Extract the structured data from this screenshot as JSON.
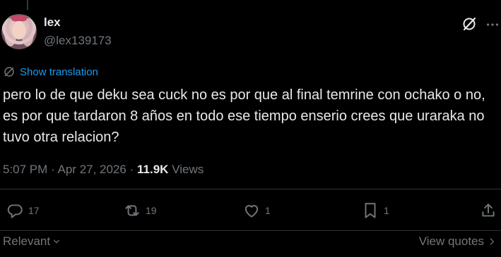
{
  "author": {
    "display_name": "lex",
    "handle": "@lex139173"
  },
  "translate": {
    "label": "Show translation"
  },
  "tweet": {
    "text": "pero lo de que deku sea cuck no es por que al final temrine con ochako o no, es por que tardaron 8 años en todo ese tiempo enserio crees que uraraka no tuvo otra relacion?"
  },
  "meta": {
    "time": "5:07 PM",
    "separator": "·",
    "date": "Apr 27, 2026",
    "views_count": "11.9K",
    "views_label": "Views"
  },
  "actions": {
    "replies": "17",
    "reposts": "19",
    "likes": "1",
    "bookmarks": "1"
  },
  "footer": {
    "sort_label": "Relevant",
    "view_quotes_label": "View quotes"
  },
  "icons": {
    "grok": "grok-icon",
    "more": "more-icon",
    "translate": "globe-slash-icon",
    "reply": "reply-icon",
    "repost": "repost-icon",
    "like": "heart-icon",
    "bookmark": "bookmark-icon",
    "share": "share-icon"
  },
  "colors": {
    "background": "#000000",
    "text": "#e7e9ea",
    "secondary": "#71767b",
    "accent": "#1d9bf0"
  }
}
